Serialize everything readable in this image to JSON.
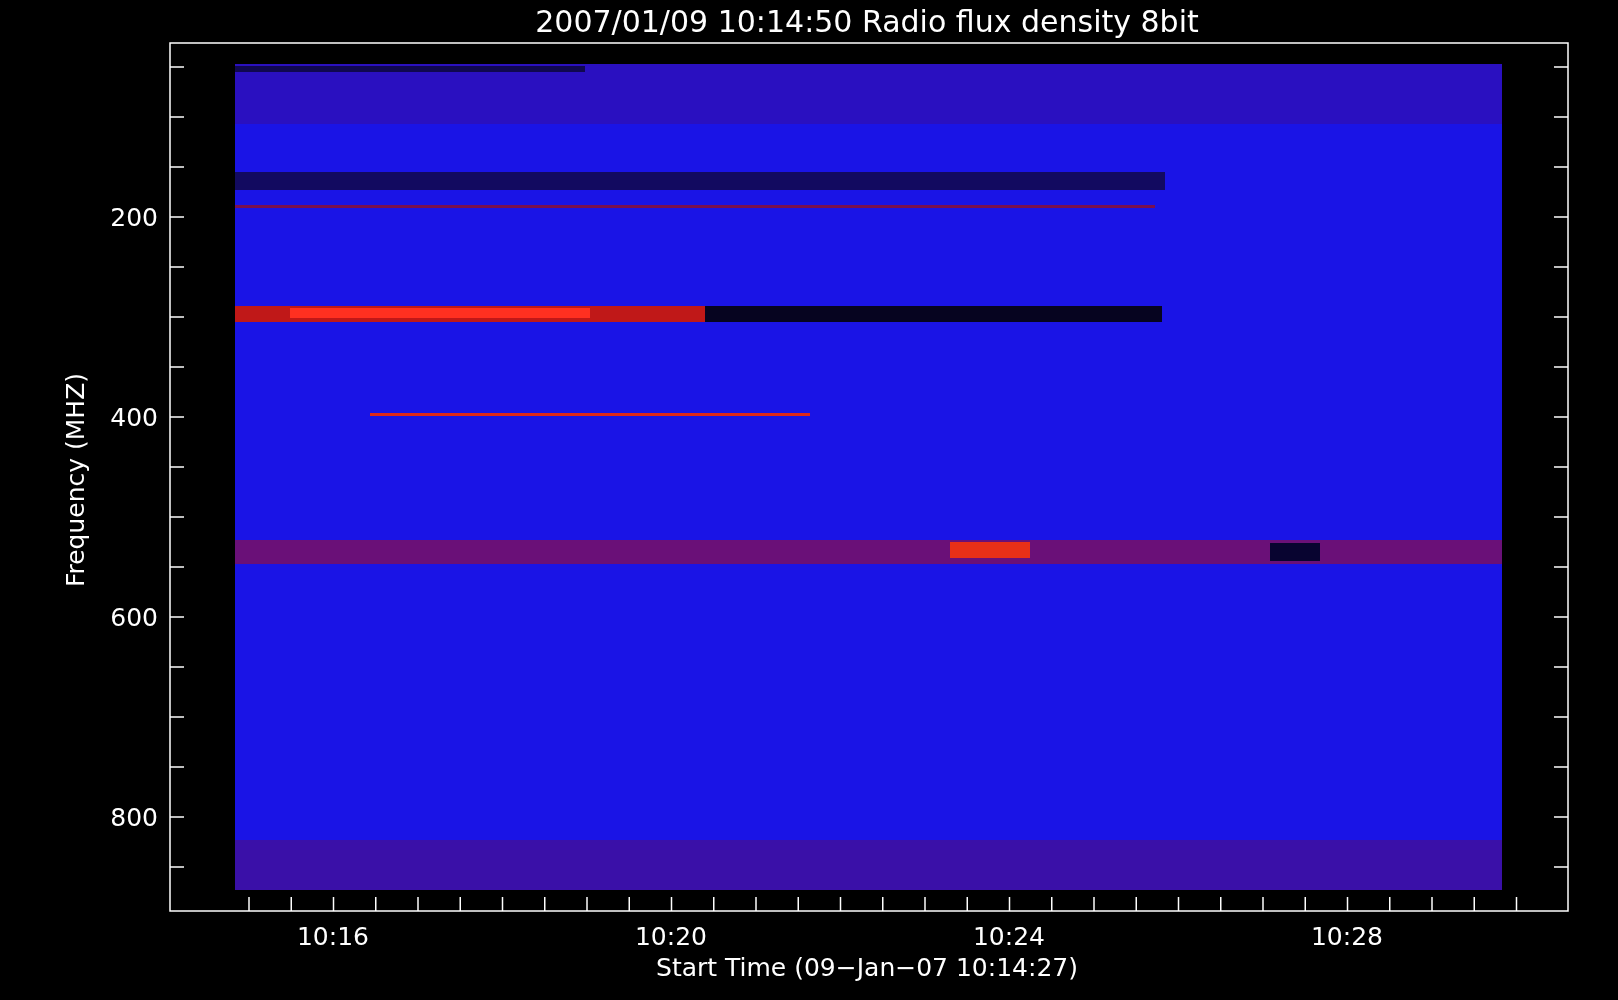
{
  "title": "2007/01/09 10:14:50 Radio flux density 8bit",
  "y_axis": {
    "label": "Frequency (MHZ)",
    "ticks": [
      "200",
      "400",
      "600",
      "800"
    ]
  },
  "x_axis": {
    "label": "Start Time (09−Jan−07 10:14:27)",
    "ticks": [
      "10:16",
      "10:20",
      "10:24",
      "10:28"
    ]
  }
}
